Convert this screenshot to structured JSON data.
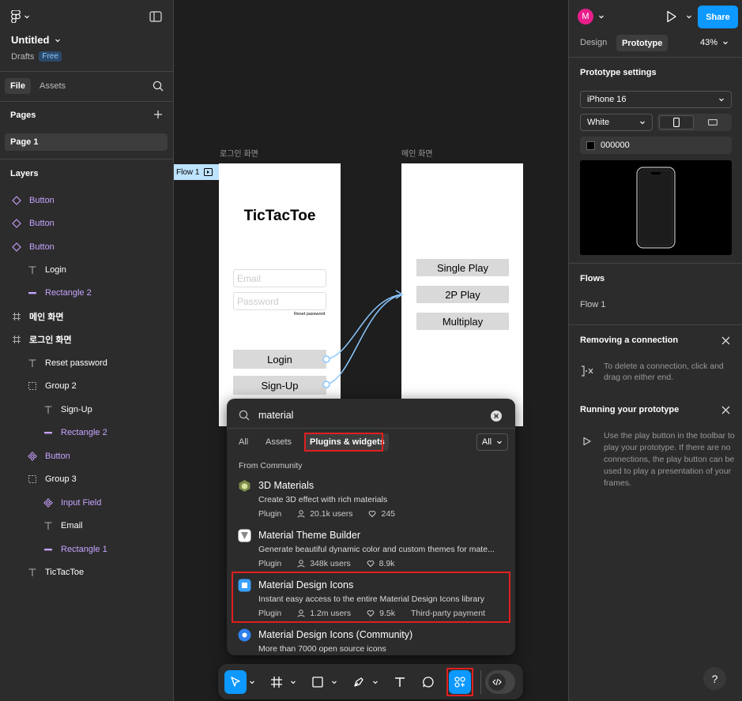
{
  "left_panel": {
    "file_name": "Untitled",
    "location": "Drafts",
    "plan_badge": "Free",
    "tabs": [
      "File",
      "Assets"
    ],
    "pages_heading": "Pages",
    "pages": [
      "Page 1"
    ],
    "layers_heading": "Layers",
    "layers": [
      {
        "label": "Button",
        "icon": "component-instance-icon"
      },
      {
        "label": "Button",
        "icon": "component-instance-icon"
      },
      {
        "label": "Button",
        "icon": "component-instance-icon"
      },
      {
        "label": "Login",
        "icon": "text-icon"
      },
      {
        "label": "Rectangle 2",
        "icon": "rectangle-icon"
      },
      {
        "label": "메인 화면",
        "icon": "frame-icon"
      },
      {
        "label": "로그인 화면",
        "icon": "frame-icon"
      },
      {
        "label": "Reset password",
        "icon": "text-icon"
      },
      {
        "label": "Group 2",
        "icon": "group-icon"
      },
      {
        "label": "Sign-Up",
        "icon": "text-icon"
      },
      {
        "label": "Rectangle 2",
        "icon": "rectangle-icon"
      },
      {
        "label": "Button",
        "icon": "component-icon"
      },
      {
        "label": "Group 3",
        "icon": "group-icon"
      },
      {
        "label": "Input Field",
        "icon": "component-icon"
      },
      {
        "label": "Email",
        "icon": "text-icon"
      },
      {
        "label": "Rectangle 1",
        "icon": "rectangle-icon"
      },
      {
        "label": "TicTacToe",
        "icon": "text-icon"
      }
    ]
  },
  "canvas": {
    "frame_login_label": "로그인 화면",
    "frame_main_label": "메인 화면",
    "flow_tag": "Flow 1",
    "app_title": "TicTacToe",
    "email_placeholder": "Email",
    "password_placeholder": "Password",
    "reset_password": "Reset password",
    "login_button": "Login",
    "signup_button": "Sign-Up",
    "single_play": "Single Play",
    "two_p_play": "2P Play",
    "multiplay": "Multiplay"
  },
  "search_popup": {
    "query": "material",
    "filters": [
      "All",
      "Assets",
      "Plugins & widgets"
    ],
    "dropdown": "All",
    "section": "From Community",
    "results": [
      {
        "title": "3D Materials",
        "desc": "Create 3D effect with rich materials",
        "type": "Plugin",
        "users": "20.1k users",
        "likes": "245",
        "extra": ""
      },
      {
        "title": "Material Theme Builder",
        "desc": "Generate beautiful dynamic color and custom themes for mate...",
        "type": "Plugin",
        "users": "348k users",
        "likes": "8.9k",
        "extra": ""
      },
      {
        "title": "Material Design Icons",
        "desc": "Instant easy access to the entire Material Design Icons library",
        "type": "Plugin",
        "users": "1.2m users",
        "likes": "9.5k",
        "extra": "Third-party payment"
      },
      {
        "title": "Material Design Icons (Community)",
        "desc": "More than 7000 open source icons",
        "type": "",
        "users": "",
        "likes": "",
        "extra": ""
      }
    ]
  },
  "right_panel": {
    "avatar_letter": "M",
    "share_label": "Share",
    "tabs": [
      "Design",
      "Prototype"
    ],
    "zoom": "43%",
    "prototype_settings_heading": "Prototype settings",
    "device": "iPhone 16",
    "device_color": "White",
    "bg_color": "000000",
    "flows_heading": "Flows",
    "flow_item": "Flow 1",
    "removing_heading": "Removing a connection",
    "removing_text": "To delete a connection, click and drag on either end.",
    "running_heading": "Running your prototype",
    "running_text": "Use the play button in the toolbar to play your prototype. If there are no connections, the play button can be used to play a presentation of your frames.",
    "help": "?"
  },
  "colors": {
    "accent": "#0d99ff",
    "component": "#c6a3ff",
    "highlight": "#e02020",
    "avatar": "#e91e8c"
  }
}
